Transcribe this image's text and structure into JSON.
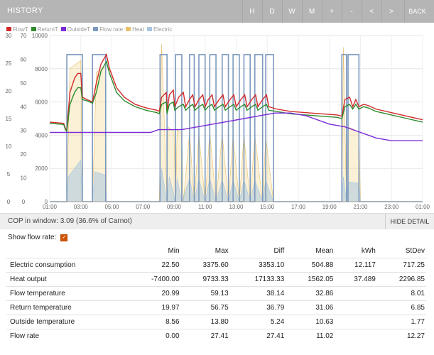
{
  "header": {
    "title": "HISTORY",
    "buttons": [
      "H",
      "D",
      "W",
      "M",
      "+",
      "-",
      "<",
      ">",
      "BACK"
    ]
  },
  "legend": [
    {
      "label": "FlowT",
      "color": "#d22a2a"
    },
    {
      "label": "ReturnT",
      "color": "#2e8b2e"
    },
    {
      "label": "OutsideT",
      "color": "#7a2bd6"
    },
    {
      "label": "Flow rate",
      "color": "#7b98bd"
    },
    {
      "label": "Heat",
      "color": "#e8c06a"
    },
    {
      "label": "Electric",
      "color": "#a9c6e0"
    }
  ],
  "chart_data": {
    "type": "line",
    "x_ticks": [
      "01:00",
      "03:00",
      "05:00",
      "07:00",
      "09:00",
      "11:00",
      "13:00",
      "15:00",
      "17:00",
      "19:00",
      "21:00",
      "23:00",
      "01:00"
    ],
    "axis_temp_ticks": [
      "30",
      "25",
      "20",
      "15",
      "10",
      "5",
      "0"
    ],
    "axis_flow_ticks": [
      "70",
      "60",
      "50",
      "40",
      "30",
      "20",
      "10",
      "0"
    ],
    "axis_power_ticks": [
      "10000",
      "8000",
      "6000",
      "4000",
      "2000",
      "0"
    ],
    "axis_temp_range": [
      0,
      30
    ],
    "axis_flow_range": [
      0,
      70
    ],
    "axis_power_range": [
      0,
      10000
    ],
    "series": [
      {
        "name": "FlowT",
        "color": "#d22a2a",
        "points": [
          [
            0,
            33.5
          ],
          [
            0.9,
            33
          ],
          [
            1.0,
            31
          ],
          [
            1.1,
            30
          ],
          [
            1.3,
            46
          ],
          [
            1.6,
            52
          ],
          [
            1.8,
            54
          ],
          [
            2.0,
            54
          ],
          [
            2.1,
            44
          ],
          [
            2.4,
            43
          ],
          [
            2.75,
            42
          ],
          [
            3.0,
            50
          ],
          [
            3.3,
            58
          ],
          [
            3.65,
            62
          ],
          [
            3.85,
            56
          ],
          [
            4.3,
            48
          ],
          [
            4.8,
            44
          ],
          [
            5.5,
            41
          ],
          [
            6.2,
            39.5
          ],
          [
            6.9,
            38.5
          ],
          [
            7.05,
            38
          ],
          [
            7.2,
            44
          ],
          [
            7.5,
            46
          ],
          [
            7.55,
            38
          ],
          [
            7.7,
            45
          ],
          [
            7.95,
            47
          ],
          [
            8.05,
            40
          ],
          [
            8.3,
            44
          ],
          [
            8.6,
            46
          ],
          [
            8.75,
            40
          ],
          [
            9.0,
            43
          ],
          [
            9.2,
            45
          ],
          [
            9.35,
            40
          ],
          [
            9.6,
            43
          ],
          [
            9.85,
            45
          ],
          [
            10.0,
            40
          ],
          [
            10.2,
            43
          ],
          [
            10.45,
            45
          ],
          [
            10.6,
            40
          ],
          [
            10.9,
            43
          ],
          [
            11.15,
            45
          ],
          [
            11.3,
            40
          ],
          [
            11.6,
            43
          ],
          [
            11.85,
            45
          ],
          [
            12.0,
            40
          ],
          [
            12.3,
            43
          ],
          [
            12.55,
            45
          ],
          [
            12.7,
            40
          ],
          [
            13.0,
            43
          ],
          [
            13.25,
            45
          ],
          [
            13.4,
            40
          ],
          [
            13.7,
            43
          ],
          [
            13.95,
            45
          ],
          [
            14.1,
            40
          ],
          [
            14.6,
            39
          ],
          [
            15.5,
            38
          ],
          [
            16.5,
            37.5
          ],
          [
            17.5,
            37
          ],
          [
            18.5,
            36.5
          ],
          [
            18.8,
            36
          ],
          [
            19.0,
            43
          ],
          [
            19.3,
            44
          ],
          [
            19.5,
            40
          ],
          [
            19.7,
            43
          ],
          [
            19.9,
            40
          ],
          [
            20.2,
            41
          ],
          [
            20.5,
            40.5
          ],
          [
            21.0,
            39
          ],
          [
            22.0,
            37.5
          ],
          [
            23.0,
            36
          ],
          [
            24.0,
            34.5
          ]
        ]
      },
      {
        "name": "ReturnT",
        "color": "#2e8b2e",
        "points": [
          [
            0,
            33
          ],
          [
            0.9,
            32.5
          ],
          [
            1.0,
            30.5
          ],
          [
            1.1,
            29.5
          ],
          [
            1.3,
            41
          ],
          [
            1.6,
            46
          ],
          [
            1.8,
            48
          ],
          [
            2.0,
            48
          ],
          [
            2.1,
            43
          ],
          [
            2.4,
            42.5
          ],
          [
            2.75,
            41.5
          ],
          [
            3.0,
            46
          ],
          [
            3.3,
            55
          ],
          [
            3.65,
            59
          ],
          [
            3.85,
            54
          ],
          [
            4.3,
            46
          ],
          [
            4.8,
            42.5
          ],
          [
            5.5,
            40
          ],
          [
            6.2,
            38.5
          ],
          [
            6.9,
            37.5
          ],
          [
            7.05,
            37
          ],
          [
            7.2,
            41
          ],
          [
            7.5,
            42
          ],
          [
            7.55,
            37
          ],
          [
            7.7,
            41
          ],
          [
            7.95,
            42
          ],
          [
            8.05,
            38.5
          ],
          [
            8.3,
            40
          ],
          [
            8.6,
            41
          ],
          [
            8.75,
            38.5
          ],
          [
            9.0,
            40
          ],
          [
            9.2,
            41
          ],
          [
            9.35,
            38.5
          ],
          [
            9.6,
            40
          ],
          [
            9.85,
            41
          ],
          [
            10.0,
            38.5
          ],
          [
            10.2,
            40
          ],
          [
            10.45,
            41
          ],
          [
            10.6,
            38.5
          ],
          [
            10.9,
            40
          ],
          [
            11.15,
            41
          ],
          [
            11.3,
            38.5
          ],
          [
            11.6,
            40
          ],
          [
            11.85,
            41
          ],
          [
            12.0,
            38.5
          ],
          [
            12.3,
            40
          ],
          [
            12.55,
            41
          ],
          [
            12.7,
            38.5
          ],
          [
            13.0,
            40
          ],
          [
            13.25,
            41
          ],
          [
            13.4,
            38.5
          ],
          [
            13.7,
            40
          ],
          [
            13.95,
            41
          ],
          [
            14.1,
            38.5
          ],
          [
            14.6,
            38
          ],
          [
            15.5,
            37
          ],
          [
            16.5,
            36.5
          ],
          [
            17.5,
            36
          ],
          [
            18.5,
            35.5
          ],
          [
            18.8,
            35
          ],
          [
            19.0,
            40
          ],
          [
            19.3,
            41
          ],
          [
            19.5,
            39
          ],
          [
            19.7,
            41
          ],
          [
            19.9,
            39
          ],
          [
            20.2,
            40
          ],
          [
            20.5,
            39.5
          ],
          [
            21.0,
            38
          ],
          [
            22.0,
            36.5
          ],
          [
            23.0,
            35
          ],
          [
            24.0,
            33.5
          ]
        ]
      },
      {
        "name": "OutsideT",
        "color": "#7a2bd6",
        "points": [
          [
            0,
            12.5
          ],
          [
            6.5,
            12.5
          ],
          [
            7.0,
            13
          ],
          [
            8.5,
            13
          ],
          [
            9.5,
            13.5
          ],
          [
            10.5,
            14
          ],
          [
            11.5,
            14.5
          ],
          [
            12.5,
            15
          ],
          [
            13.5,
            15.5
          ],
          [
            14.5,
            16
          ],
          [
            15.5,
            16
          ],
          [
            16.5,
            15.5
          ],
          [
            17.0,
            15
          ],
          [
            18.0,
            14
          ],
          [
            19.0,
            13.5
          ],
          [
            20.0,
            12.5
          ],
          [
            21.0,
            11.5
          ],
          [
            22.0,
            11
          ],
          [
            24.0,
            11
          ]
        ]
      },
      {
        "name": "Flow rate",
        "color": "#7b98bd",
        "type": "step",
        "on_intervals": [
          [
            1.1,
            2.1
          ],
          [
            2.75,
            3.6
          ],
          [
            7.1,
            7.55
          ],
          [
            8.1,
            8.5
          ],
          [
            9.0,
            9.3
          ],
          [
            9.6,
            10.0
          ],
          [
            10.3,
            10.7
          ],
          [
            11.1,
            11.5
          ],
          [
            11.8,
            12.2
          ],
          [
            12.5,
            12.9
          ],
          [
            13.2,
            13.7
          ],
          [
            13.9,
            14.4
          ],
          [
            18.8,
            19.1
          ],
          [
            19.2,
            19.9
          ]
        ],
        "on_value": 27.41,
        "off_value": 0
      },
      {
        "name": "Heat",
        "color": "#e8c06a",
        "type": "area",
        "points": [
          [
            0,
            0
          ],
          [
            1.1,
            0
          ],
          [
            1.3,
            8000
          ],
          [
            2.0,
            8500
          ],
          [
            2.1,
            0
          ],
          [
            2.75,
            0
          ],
          [
            3.0,
            7800
          ],
          [
            3.6,
            8100
          ],
          [
            3.65,
            0
          ],
          [
            7.05,
            0
          ],
          [
            7.2,
            9500
          ],
          [
            7.55,
            0
          ],
          [
            7.6,
            4500
          ],
          [
            8.0,
            4200
          ],
          [
            8.1,
            0
          ],
          [
            8.2,
            4300
          ],
          [
            8.5,
            4100
          ],
          [
            8.6,
            0
          ],
          [
            9.0,
            4200
          ],
          [
            9.3,
            0
          ],
          [
            9.6,
            4100
          ],
          [
            10.0,
            0
          ],
          [
            10.3,
            4200
          ],
          [
            10.7,
            0
          ],
          [
            11.1,
            4100
          ],
          [
            11.5,
            0
          ],
          [
            11.8,
            4000
          ],
          [
            12.2,
            0
          ],
          [
            12.5,
            4000
          ],
          [
            12.9,
            0
          ],
          [
            13.2,
            4000
          ],
          [
            13.7,
            0
          ],
          [
            13.9,
            3900
          ],
          [
            14.4,
            0
          ],
          [
            18.8,
            0
          ],
          [
            18.9,
            9300
          ],
          [
            19.1,
            0
          ],
          [
            19.2,
            4500
          ],
          [
            19.9,
            4200
          ],
          [
            20.0,
            0
          ],
          [
            24.0,
            0
          ]
        ]
      },
      {
        "name": "Electric",
        "color": "#a9c6e0",
        "type": "area",
        "points": [
          [
            0,
            0
          ],
          [
            1.1,
            0
          ],
          [
            1.2,
            1500
          ],
          [
            2.0,
            2500
          ],
          [
            2.1,
            0
          ],
          [
            2.75,
            0
          ],
          [
            2.9,
            1800
          ],
          [
            3.6,
            1600
          ],
          [
            3.65,
            0
          ],
          [
            7.1,
            0
          ],
          [
            7.2,
            2000
          ],
          [
            7.55,
            0
          ],
          [
            7.7,
            1500
          ],
          [
            8.1,
            0
          ],
          [
            8.2,
            1400
          ],
          [
            8.5,
            0
          ],
          [
            9.0,
            1400
          ],
          [
            9.3,
            0
          ],
          [
            9.6,
            1400
          ],
          [
            10.0,
            0
          ],
          [
            10.3,
            1400
          ],
          [
            10.7,
            0
          ],
          [
            11.1,
            1300
          ],
          [
            11.5,
            0
          ],
          [
            11.8,
            1300
          ],
          [
            12.2,
            0
          ],
          [
            12.5,
            1300
          ],
          [
            12.9,
            0
          ],
          [
            13.2,
            1300
          ],
          [
            13.7,
            0
          ],
          [
            13.9,
            1300
          ],
          [
            14.4,
            0
          ],
          [
            18.8,
            0
          ],
          [
            18.9,
            1500
          ],
          [
            19.1,
            0
          ],
          [
            19.2,
            1200
          ],
          [
            19.9,
            1100
          ],
          [
            20.0,
            0
          ],
          [
            24.0,
            0
          ]
        ]
      }
    ]
  },
  "cop": {
    "prefix": "COP in window:",
    "value": "3.09",
    "suffix": "(36.6% of Carnot)",
    "hide_label": "HIDE DETAIL"
  },
  "show_flow": {
    "label": "Show flow rate:",
    "checked": true
  },
  "table": {
    "headers": [
      "",
      "Min",
      "Max",
      "Diff",
      "Mean",
      "kWh",
      "StDev"
    ],
    "rows": [
      [
        "Electric consumption",
        "22.50",
        "3375.60",
        "3353.10",
        "504.88",
        "12.117",
        "717.25"
      ],
      [
        "Heat output",
        "-7400.00",
        "9733.33",
        "17133.33",
        "1562.05",
        "37.489",
        "2296.85"
      ],
      [
        "Flow temperature",
        "20.99",
        "59.13",
        "38.14",
        "32.86",
        "",
        "8.01"
      ],
      [
        "Return temperature",
        "19.97",
        "56.75",
        "36.79",
        "31.06",
        "",
        "6.85"
      ],
      [
        "Outside temperature",
        "8.56",
        "13.80",
        "5.24",
        "10.63",
        "",
        "1.77"
      ],
      [
        "Flow rate",
        "0.00",
        "27.41",
        "27.41",
        "11.02",
        "",
        "12.27"
      ]
    ]
  }
}
